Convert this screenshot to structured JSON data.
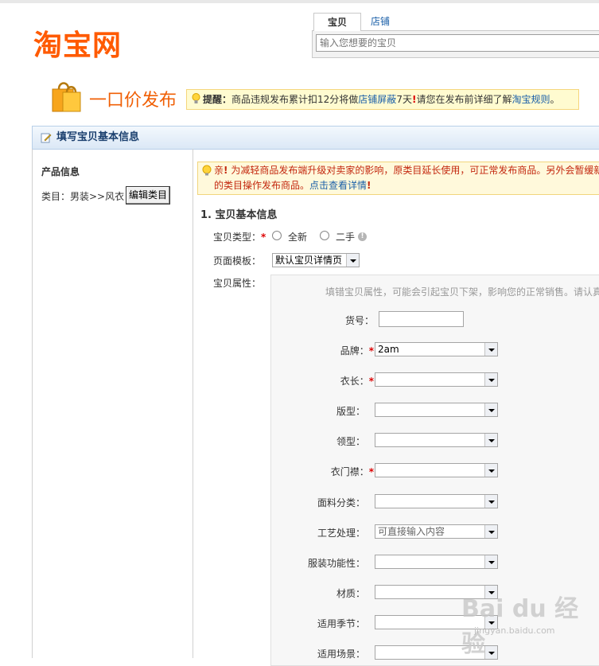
{
  "header": {
    "logo_text": "淘宝网",
    "search": {
      "tab_items": "宝贝",
      "tab_shops": "店铺",
      "placeholder": "输入您想要的宝贝"
    }
  },
  "publish": {
    "title": "一口价发布",
    "notice_label": "提醒：",
    "notice_text": "商品违规发布累计扣12分将做",
    "notice_link1": "店铺屏蔽",
    "notice_text2": "7天",
    "notice_text3": "请您在发布前详细了解",
    "notice_link2": "淘宝规则",
    "notice_end": "。"
  },
  "section": {
    "title": "填写宝贝基本信息"
  },
  "left_panel": {
    "heading": "产品信息",
    "category_label": "类目：男装>>风衣",
    "edit_button": "编辑类目"
  },
  "warning": {
    "line1_prefix": "亲",
    "line1": "为减轻商品发布端升级对卖家的影响，原类目延长使用，可正常发布商品。另外会暂缓新",
    "line2": "的类目操作发布商品。",
    "link": "点击查看详情"
  },
  "form": {
    "step_title": "1. 宝贝基本信息",
    "type_label": "宝贝类型：",
    "type_options": [
      "全新",
      "二手"
    ],
    "template_label": "页面模板：",
    "template_value": "默认宝贝详情页",
    "attr_label": "宝贝属性：",
    "attr_hint": "填错宝贝属性，可能会引起宝贝下架，影响您的正常销售。请认真",
    "fields": [
      {
        "label": "货号：",
        "required": false,
        "kind": "text",
        "value": ""
      },
      {
        "label": "品牌：",
        "required": true,
        "kind": "select",
        "value": "2am"
      },
      {
        "label": "衣长：",
        "required": true,
        "kind": "select",
        "value": ""
      },
      {
        "label": "版型：",
        "required": false,
        "kind": "select",
        "value": ""
      },
      {
        "label": "领型：",
        "required": false,
        "kind": "select",
        "value": ""
      },
      {
        "label": "衣门襟：",
        "required": true,
        "kind": "select",
        "value": ""
      },
      {
        "label": "面料分类：",
        "required": false,
        "kind": "select",
        "value": ""
      },
      {
        "label": "工艺处理：",
        "required": false,
        "kind": "select",
        "value": "",
        "placeholder": "可直接输入内容"
      },
      {
        "label": "服装功能性：",
        "required": false,
        "kind": "select",
        "value": ""
      },
      {
        "label": "材质：",
        "required": false,
        "kind": "select",
        "value": ""
      },
      {
        "label": "适用季节：",
        "required": false,
        "kind": "select",
        "value": ""
      },
      {
        "label": "适用场景：",
        "required": false,
        "kind": "select",
        "value": ""
      }
    ]
  },
  "watermark": {
    "main": "Bai du 经验",
    "sub": "jingyan.baidu.com"
  }
}
